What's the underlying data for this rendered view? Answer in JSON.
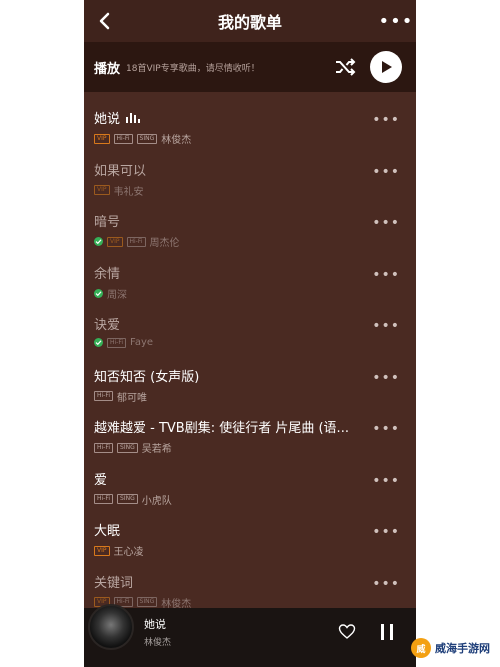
{
  "header": {
    "title": "我的歌单"
  },
  "playbar": {
    "label": "播放",
    "subtitle": "18首VIP专享歌曲，请尽情收听！"
  },
  "songs": [
    {
      "title": "她说",
      "artist": "林俊杰",
      "badges": [
        "VIP",
        "Hi-Fi",
        "SING"
      ],
      "playing": true,
      "downloaded": false,
      "dim": false
    },
    {
      "title": "如果可以",
      "artist": "韦礼安",
      "badges": [
        "VIP"
      ],
      "playing": false,
      "downloaded": false,
      "dim": true
    },
    {
      "title": "暗号",
      "artist": "周杰伦",
      "badges": [
        "VIP",
        "Hi-Fi"
      ],
      "playing": false,
      "downloaded": true,
      "dim": true
    },
    {
      "title": "余情",
      "artist": "周深",
      "badges": [],
      "playing": false,
      "downloaded": true,
      "dim": true
    },
    {
      "title": "诀爱",
      "artist": "Faye",
      "badges": [
        "Hi-Fi"
      ],
      "playing": false,
      "downloaded": true,
      "dim": true
    },
    {
      "title": "知否知否 (女声版)",
      "artist": "郁可唯",
      "badges": [
        "Hi-Fi"
      ],
      "playing": false,
      "downloaded": false,
      "dim": false
    },
    {
      "title": "越难越爱 - TVB剧集: 使徒行者 片尾曲 (语...",
      "artist": "吴若希",
      "badges": [
        "Hi-Fi",
        "SING"
      ],
      "playing": false,
      "downloaded": false,
      "dim": false
    },
    {
      "title": "爱",
      "artist": "小虎队",
      "badges": [
        "Hi-Fi",
        "SING"
      ],
      "playing": false,
      "downloaded": false,
      "dim": false
    },
    {
      "title": "大眠",
      "artist": "王心凌",
      "badges": [
        "VIP"
      ],
      "playing": false,
      "downloaded": false,
      "dim": false
    },
    {
      "title": "关键词",
      "artist": "林俊杰",
      "badges": [
        "VIP",
        "Hi-Fi",
        "SING"
      ],
      "playing": false,
      "downloaded": false,
      "dim": true
    }
  ],
  "player": {
    "title": "她说",
    "artist": "林俊杰"
  },
  "watermark": {
    "logo_text": "威",
    "text": "威海手游网"
  },
  "icons": {
    "back": "chevron-left-icon",
    "more": "more-icon",
    "shuffle": "shuffle-icon",
    "play": "play-icon",
    "heart": "heart-icon",
    "pause": "pause-icon",
    "eq": "equalizer-icon",
    "check": "check-icon"
  },
  "colors": {
    "background": "#4a2a22",
    "header": "#3f231c",
    "playbar": "#2c1711",
    "vip": "#d8791c",
    "downloaded": "#35b057",
    "player": "#1a1412"
  }
}
